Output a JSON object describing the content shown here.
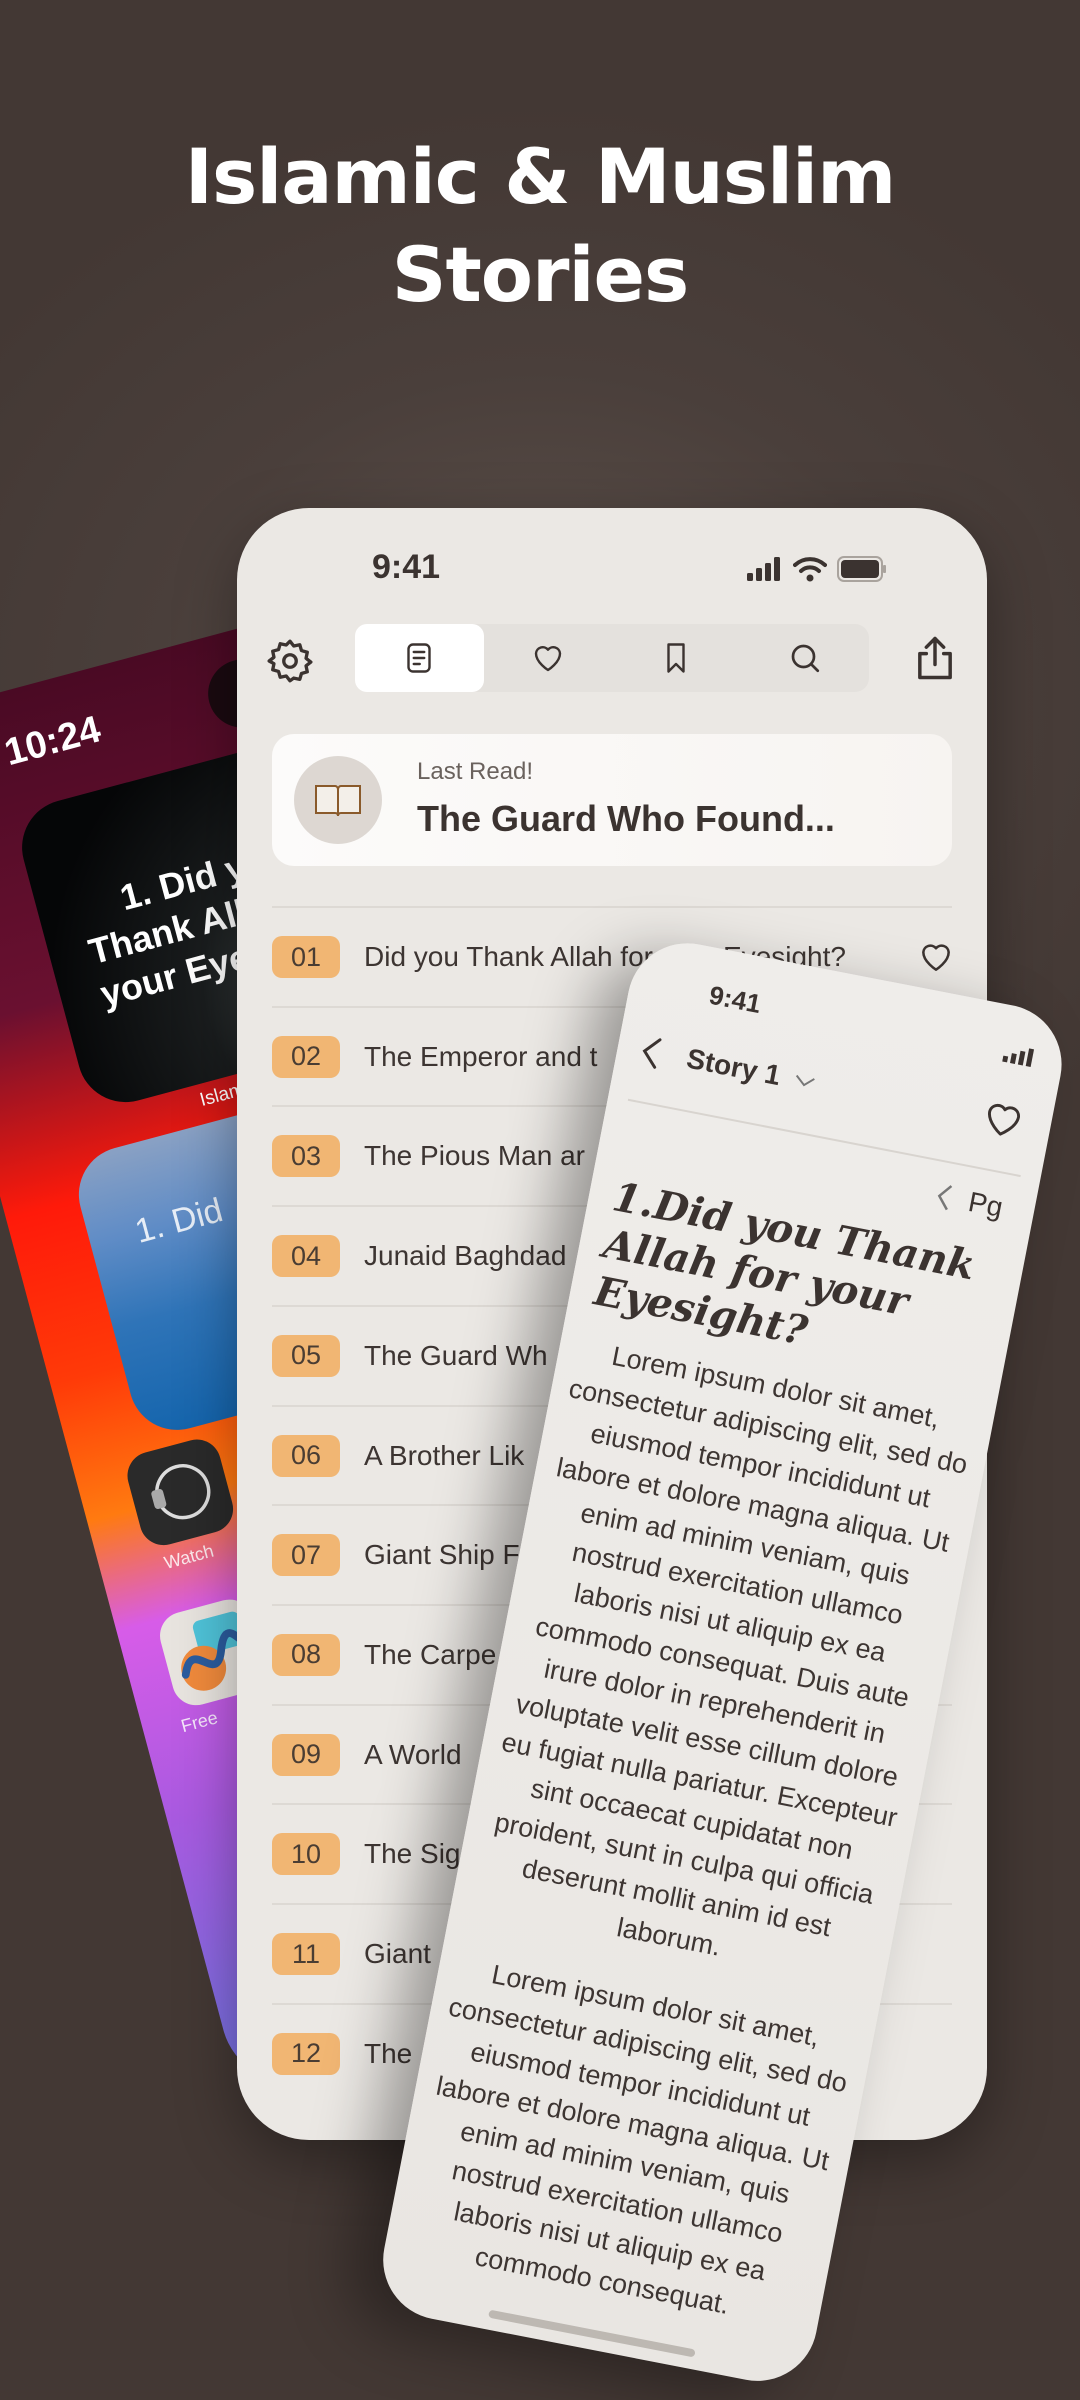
{
  "headline": {
    "line1": "Islamic & Muslim",
    "line2": "Stories"
  },
  "colors": {
    "background": "#463b37",
    "accent_badge": "#f1b673",
    "phone_bg": "#ebe8e4"
  },
  "left_phone": {
    "time": "10:24",
    "widget_text": "1. Did you Thank Allah for your Eyesight?",
    "widget_label": "Islamic Stories",
    "widget2_text": "1. Did",
    "apps": [
      {
        "label": "Watch",
        "icon": "watch-icon"
      },
      {
        "label": "Free",
        "icon": "freeform-icon"
      }
    ]
  },
  "main_phone": {
    "time": "9:41",
    "tabs": [
      {
        "icon": "list-icon",
        "active": true
      },
      {
        "icon": "heart-icon"
      },
      {
        "icon": "bookmark-icon"
      },
      {
        "icon": "search-icon"
      }
    ],
    "last_read": {
      "label": "Last Read!",
      "title": "The Guard Who Found...",
      "icon": "open-book-icon"
    },
    "stories": [
      {
        "num": "01",
        "title": "Did you Thank Allah for your Eyesight?"
      },
      {
        "num": "02",
        "title": "The Emperor and t"
      },
      {
        "num": "03",
        "title": "The Pious Man ar"
      },
      {
        "num": "04",
        "title": "Junaid Baghdad"
      },
      {
        "num": "05",
        "title": "The Guard Wh"
      },
      {
        "num": "06",
        "title": "A Brother Lik"
      },
      {
        "num": "07",
        "title": "Giant Ship F"
      },
      {
        "num": "08",
        "title": "The Carpe"
      },
      {
        "num": "09",
        "title": "A World"
      },
      {
        "num": "10",
        "title": "The Sig"
      },
      {
        "num": "11",
        "title": "Giant"
      },
      {
        "num": "12",
        "title": "The"
      }
    ]
  },
  "reader_phone": {
    "time": "9:41",
    "story_selector": "Story 1",
    "page_label": "Pg",
    "title": "1.Did you Thank Allah for your Eyesight?",
    "paragraphs": [
      "Lorem ipsum dolor sit amet, consectetur adipiscing elit, sed do eiusmod tempor incididunt ut labore et dolore magna aliqua. Ut enim ad minim veniam, quis nostrud exercitation ullamco laboris nisi ut aliquip ex ea commodo consequat. Duis aute irure dolor in reprehenderit in voluptate velit esse cillum dolore eu fugiat nulla pariatur. Excepteur sint occaecat cupidatat non proident, sunt in culpa qui officia deserunt mollit anim id est laborum.",
      "Lorem ipsum dolor sit amet, consectetur adipiscing elit, sed do eiusmod tempor incididunt ut labore et dolore magna aliqua. Ut enim ad minim veniam, quis nostrud exercitation ullamco laboris nisi ut aliquip ex ea commodo consequat."
    ]
  }
}
